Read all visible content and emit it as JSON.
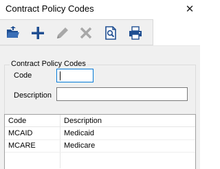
{
  "window": {
    "title": "Contract Policy Codes",
    "close_glyph": "✕"
  },
  "toolbar": {
    "buttons": [
      {
        "icon": "open-folder-icon",
        "enabled": true
      },
      {
        "icon": "add-icon",
        "enabled": true
      },
      {
        "icon": "edit-icon",
        "enabled": false
      },
      {
        "icon": "delete-icon",
        "enabled": false
      },
      {
        "icon": "preview-icon",
        "enabled": true
      },
      {
        "icon": "print-icon",
        "enabled": true
      }
    ]
  },
  "form": {
    "group_title": "Contract Policy Codes",
    "code_label": "Code",
    "code_value": "",
    "description_label": "Description",
    "description_value": ""
  },
  "list": {
    "columns": [
      "Code",
      "Description"
    ],
    "rows": [
      {
        "code": "MCAID",
        "description": "Medicaid"
      },
      {
        "code": "MCARE",
        "description": "Medicare"
      }
    ]
  },
  "colors": {
    "accent_blue": "#1f4e91",
    "focus_border": "#0078d7",
    "disabled_gray": "#a8a8a8"
  }
}
